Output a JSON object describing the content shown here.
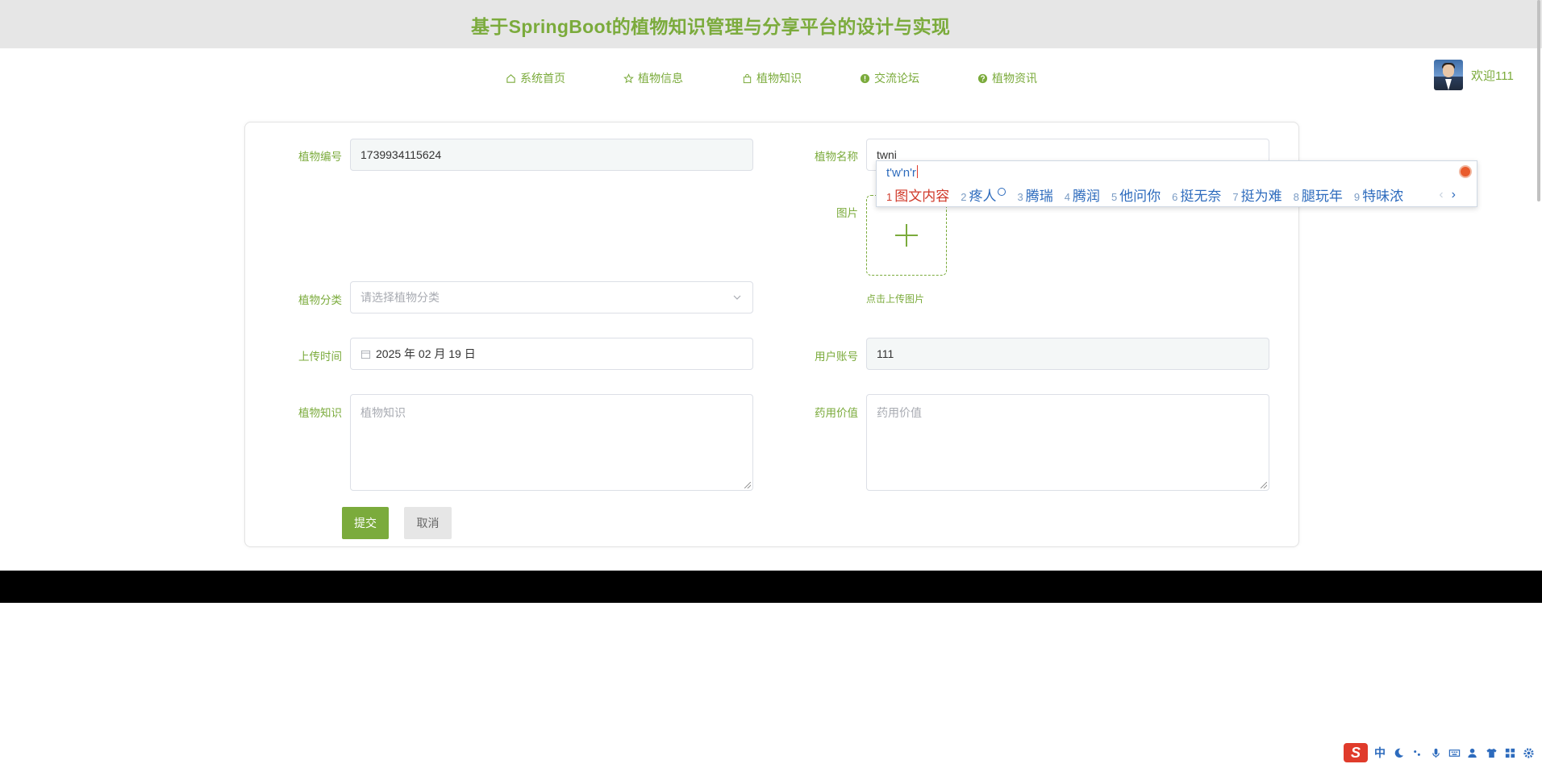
{
  "header": {
    "site_title": "基于SpringBoot的植物知识管理与分享平台的设计与实现"
  },
  "nav": {
    "items": [
      {
        "label": "系统首页",
        "icon": "home-icon"
      },
      {
        "label": "植物信息",
        "icon": "star-icon"
      },
      {
        "label": "植物知识",
        "icon": "bag-icon"
      },
      {
        "label": "交流论坛",
        "icon": "info-circle-icon"
      },
      {
        "label": "植物资讯",
        "icon": "question-circle-icon"
      }
    ]
  },
  "user": {
    "welcome": "欢迎111"
  },
  "form": {
    "plant_code_label": "植物编号",
    "plant_code_value": "1739934115624",
    "plant_name_label": "植物名称",
    "plant_name_value": "twni",
    "image_label": "图片",
    "upload_hint": "点击上传图片",
    "category_label": "植物分类",
    "category_placeholder": "请选择植物分类",
    "upload_time_label": "上传时间",
    "upload_time_value": "2025 年 02 月 19 日",
    "user_account_label": "用户账号",
    "user_account_value": "111",
    "knowledge_label": "植物知识",
    "knowledge_placeholder": "植物知识",
    "medicinal_label": "药用价值",
    "medicinal_placeholder": "药用价值",
    "submit_label": "提交",
    "cancel_label": "取消"
  },
  "ime": {
    "composition": "t'w'n'r",
    "candidates": [
      {
        "num": "1",
        "text": "图文内容"
      },
      {
        "num": "2",
        "text": "疼人"
      },
      {
        "num": "3",
        "text": "腾瑞"
      },
      {
        "num": "4",
        "text": "腾润"
      },
      {
        "num": "5",
        "text": "他问你"
      },
      {
        "num": "6",
        "text": "挺无奈"
      },
      {
        "num": "7",
        "text": "挺为难"
      },
      {
        "num": "8",
        "text": "腿玩年"
      },
      {
        "num": "9",
        "text": "特味浓"
      }
    ],
    "next_symbol": "›",
    "prev_symbol": "‹",
    "toolbar_lang": "中"
  },
  "colors": {
    "accent": "#7bab3c",
    "header_bg": "#e6e6e6",
    "footer_bg": "#000000",
    "ime_blue": "#2d6bbd",
    "ime_red": "#d03a2a"
  }
}
